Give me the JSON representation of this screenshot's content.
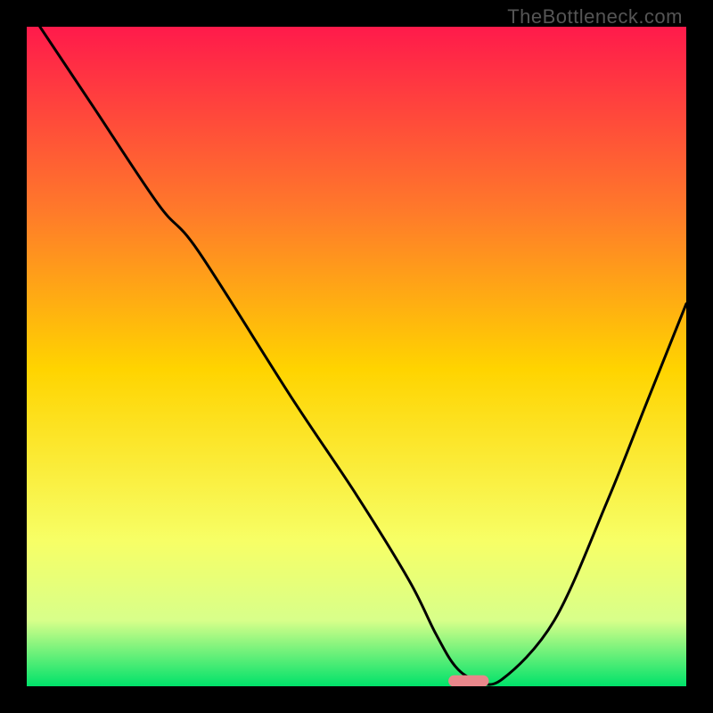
{
  "watermark": "TheBottleneck.com",
  "chart_data": {
    "type": "line",
    "title": "",
    "xlabel": "",
    "ylabel": "",
    "xlim": [
      0,
      100
    ],
    "ylim": [
      0,
      100
    ],
    "grid": false,
    "legend": false,
    "colors": {
      "gradient_top": "#ff1a4b",
      "gradient_upper_mid": "#ff7a2a",
      "gradient_mid": "#ffd400",
      "gradient_lower_mid": "#f7ff66",
      "gradient_low_mid2": "#d8ff8a",
      "gradient_bottom": "#00e26a",
      "curve": "#000000",
      "marker_fill": "#e9878b",
      "marker_stroke": "#e9878b"
    },
    "series": [
      {
        "name": "bottleneck-curve",
        "type": "line",
        "x": [
          2,
          10,
          20,
          26,
          40,
          50,
          58,
          62,
          65,
          68,
          72,
          80,
          88,
          94,
          100
        ],
        "y": [
          100,
          88,
          73,
          66,
          44,
          29,
          16,
          8,
          3,
          1,
          1,
          10,
          28,
          43,
          58
        ]
      }
    ],
    "marker": {
      "shape": "rounded-bar",
      "x_center": 67,
      "y": 0.8,
      "width": 6,
      "height": 1.6
    },
    "annotations": []
  }
}
